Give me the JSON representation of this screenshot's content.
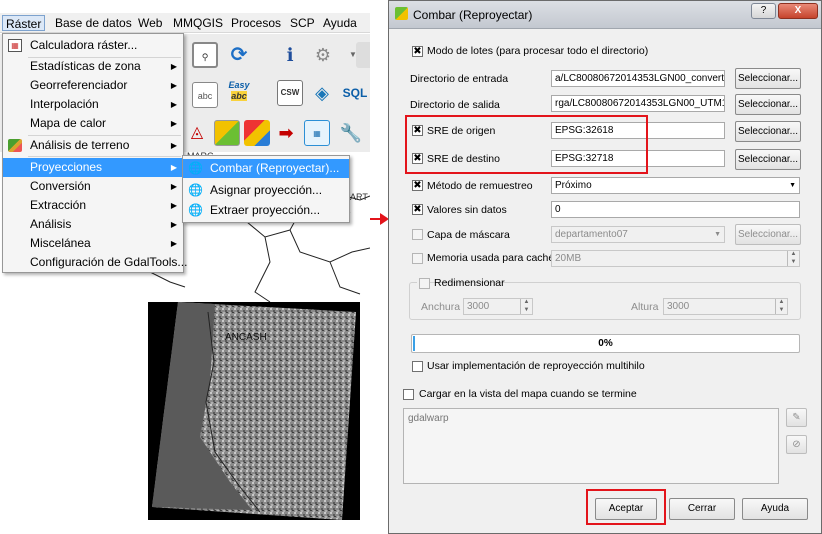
{
  "menubar": {
    "items": [
      "Ráster",
      "Base de datos",
      "Web",
      "MMQGIS",
      "Procesos",
      "SCP",
      "Ayuda"
    ]
  },
  "toolbar": {
    "easy_icon_text": "Easy",
    "easy_icon_sub": "abc",
    "csw_icon_text": "CSW",
    "sql_icon_text": "SQL",
    "abc_icon_text": "abc"
  },
  "raster_menu": {
    "items": [
      {
        "label": "Calculadora ráster...",
        "icon": "calculator-icon",
        "submenu": false
      },
      {
        "label": "Estadísticas de zona",
        "submenu": true
      },
      {
        "label": "Georreferenciador",
        "submenu": true
      },
      {
        "label": "Interpolación",
        "submenu": true
      },
      {
        "label": "Mapa de calor",
        "submenu": true
      },
      {
        "label": "Análisis de terreno",
        "icon": "terrain-icon",
        "submenu": true
      },
      {
        "label": "Proyecciones",
        "submenu": true
      },
      {
        "label": "Conversión",
        "submenu": true
      },
      {
        "label": "Extracción",
        "submenu": true
      },
      {
        "label": "Análisis",
        "submenu": true
      },
      {
        "label": "Miscelánea",
        "submenu": true
      },
      {
        "label": "Configuración de GdalTools...",
        "submenu": false
      }
    ]
  },
  "projections_submenu": {
    "items": [
      {
        "label": "Combar (Reproyectar)...",
        "icon": "warp-icon"
      },
      {
        "label": "Asignar proyección...",
        "icon": "assign-projection-icon"
      },
      {
        "label": "Extraer proyección...",
        "icon": "extract-projection-icon"
      }
    ]
  },
  "map": {
    "label_ancash": "ANCASH",
    "partial_labels": [
      "MARC",
      "ART"
    ]
  },
  "dialog": {
    "title": "Combar (Reproyectar)",
    "window_buttons": [
      "?",
      "X"
    ],
    "batch_mode_label": "Modo de lotes (para procesar todo el directorio)",
    "input_dir_label": "Directorio de entrada",
    "input_dir_value": "a/LC80080672014353LGN00_converted",
    "output_dir_label": "Directorio de salida",
    "output_dir_value": "rga/LC80080672014353LGN00_UTM18S",
    "source_srs_label": "SRE de origen",
    "source_srs_value": "EPSG:32618",
    "target_srs_label": "SRE de destino",
    "target_srs_value": "EPSG:32718",
    "resampling_label": "Método de remuestreo",
    "resampling_value": "Próximo",
    "nodata_label": "Valores sin datos",
    "nodata_value": "0",
    "mask_label": "Capa de máscara",
    "mask_value": "departamento07",
    "cache_label": "Memoria usada para caché",
    "cache_value": "20MB",
    "resize_label": "Redimensionar",
    "width_label": "Anchura",
    "width_value": "3000",
    "height_label": "Altura",
    "height_value": "3000",
    "progress_text": "0%",
    "progress": 0.0,
    "multithread_label": "Usar implementación de reproyección multihilo",
    "load_label": "Cargar en la vista del mapa cuando se termine",
    "command_text": "gdalwarp",
    "select_button": "Seleccionar...",
    "accept_button": "Aceptar",
    "close_button": "Cerrar",
    "help_button": "Ayuda"
  },
  "colors": {
    "highlight": "#3399ff",
    "annotation_red": "#e3141b"
  }
}
